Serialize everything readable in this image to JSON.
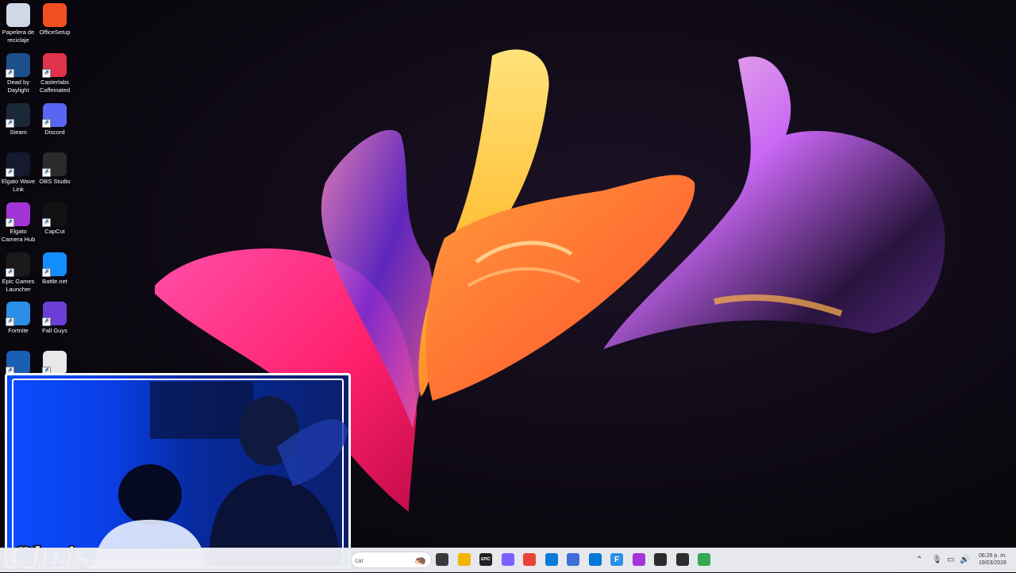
{
  "desktop": {
    "icons": [
      {
        "label": "Papelera de reciclaje",
        "icon": "recycle-bin-icon",
        "color": "#cfd8e6"
      },
      {
        "label": "OfficeSetup",
        "icon": "office-icon",
        "color": "#f25022"
      },
      {
        "label": "Dead by Daylight",
        "icon": "dead-by-daylight-icon",
        "color": "#1e4f8c"
      },
      {
        "label": "Casterlabs Caffeinated",
        "icon": "casterlabs-icon",
        "color": "#e0324a"
      },
      {
        "label": "Steam",
        "icon": "steam-icon",
        "color": "#1b2838"
      },
      {
        "label": "Discord",
        "icon": "discord-icon",
        "color": "#5865f2"
      },
      {
        "label": "Elgato Wave Link",
        "icon": "wave-link-icon",
        "color": "#151a2e"
      },
      {
        "label": "OBS Studio",
        "icon": "obs-icon",
        "color": "#2b2b2b"
      },
      {
        "label": "Elgato Camera Hub",
        "icon": "camera-hub-icon",
        "color": "#a335d8"
      },
      {
        "label": "CapCut",
        "icon": "capcut-icon",
        "color": "#111111"
      },
      {
        "label": "Epic Games Launcher",
        "icon": "epic-games-icon",
        "color": "#1a1a1a"
      },
      {
        "label": "Battle.net",
        "icon": "battle-net-icon",
        "color": "#148eff"
      },
      {
        "label": "Fortnite",
        "icon": "fortnite-icon",
        "color": "#2b8fe8"
      },
      {
        "label": "Fall Guys",
        "icon": "fall-guys-icon",
        "color": "#6b3fd6"
      },
      {
        "label": "",
        "icon": "rocket-league-icon",
        "color": "#1a5fb4"
      },
      {
        "label": "",
        "icon": "watch-dogs-icon",
        "color": "#e8e8e8"
      }
    ]
  },
  "webcam": {
    "name_label": "Chris"
  },
  "taskbar": {
    "search_placeholder": "car",
    "apps": [
      {
        "icon": "task-view-icon",
        "color": "#3a3a3a",
        "glyph": ""
      },
      {
        "icon": "file-explorer-icon",
        "color": "#f4b400",
        "glyph": ""
      },
      {
        "icon": "epic-games-taskbar-icon",
        "color": "#222222",
        "glyph": "EPIC"
      },
      {
        "icon": "copilot-icon",
        "color": "#7b61ff",
        "glyph": ""
      },
      {
        "icon": "chrome-icon",
        "color": "#ea4335",
        "glyph": ""
      },
      {
        "icon": "edge-icon",
        "color": "#0c7bd6",
        "glyph": ""
      },
      {
        "icon": "settings-icon",
        "color": "#3d6fd8",
        "glyph": ""
      },
      {
        "icon": "microsoft-store-icon",
        "color": "#0078d4",
        "glyph": ""
      },
      {
        "icon": "fortnite-taskbar-icon",
        "color": "#2b8fe8",
        "glyph": "F"
      },
      {
        "icon": "camera-hub-taskbar-icon",
        "color": "#a335d8",
        "glyph": ""
      },
      {
        "icon": "obs-taskbar-icon",
        "color": "#2b2b2b",
        "glyph": ""
      },
      {
        "icon": "terminal-icon",
        "color": "#2d2d2d",
        "glyph": ""
      },
      {
        "icon": "chrome-profile-icon",
        "color": "#34a853",
        "glyph": ""
      }
    ],
    "time": "06:26 p. m.",
    "date": "19/03/2026"
  }
}
